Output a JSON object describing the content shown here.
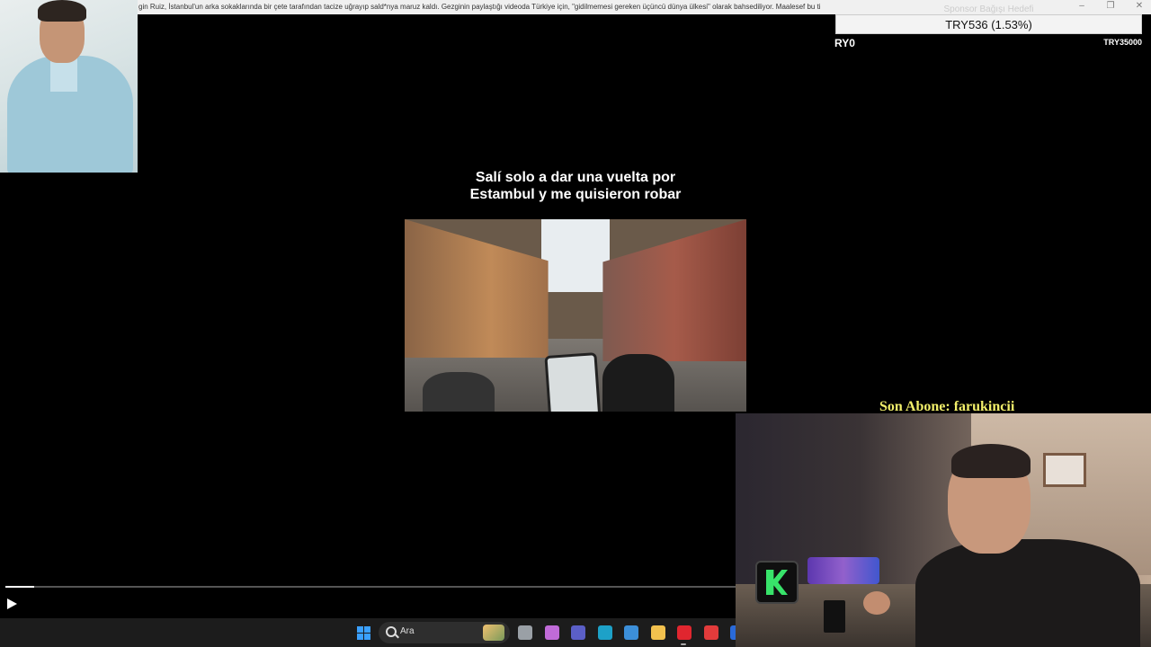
{
  "top_bar": {
    "ticker_text": "gin Ruiz, İstanbul'un arka sokaklarında bir çete tarafından tacize uğrayıp sald*nya maruz kaldı. Gezginin paylaştığı videoda Türkiye için, \"gidilmemesi gereken üçüncü dünya ülkesi\" olarak bahsediliyor. Maalesef bu ti",
    "window_controls": [
      "–",
      "❐",
      "✕"
    ]
  },
  "overlay": {
    "faded_text": "Sponsor Bağışı Hedefi",
    "value": "TRY536 (1.53%)",
    "left_label": "RY0",
    "right_label": "TRY35000"
  },
  "video_player": {
    "caption_line1": "Salí solo a dar una vuelta por",
    "caption_line2": "Estambul y me quisieron robar",
    "progress": 0.04
  },
  "taskbar": {
    "search_placeholder": "Ara",
    "icons": [
      {
        "name": "task-view-icon",
        "color": "#9aa0a6"
      },
      {
        "name": "copilot-icon",
        "color": "#c06bd8"
      },
      {
        "name": "teams-icon",
        "color": "#5b5fc7"
      },
      {
        "name": "edge-icon",
        "color": "#1da1c8"
      },
      {
        "name": "store-icon",
        "color": "#3c8fd9"
      },
      {
        "name": "file-explorer-icon",
        "color": "#f2c14e"
      },
      {
        "name": "opera-icon",
        "color": "#e0262f"
      },
      {
        "name": "wps-icon",
        "color": "#e23b3b"
      },
      {
        "name": "app-icon",
        "color": "#2a6ad8"
      }
    ]
  },
  "stream": {
    "last_sub_label": "Son Abone: farukincii"
  }
}
